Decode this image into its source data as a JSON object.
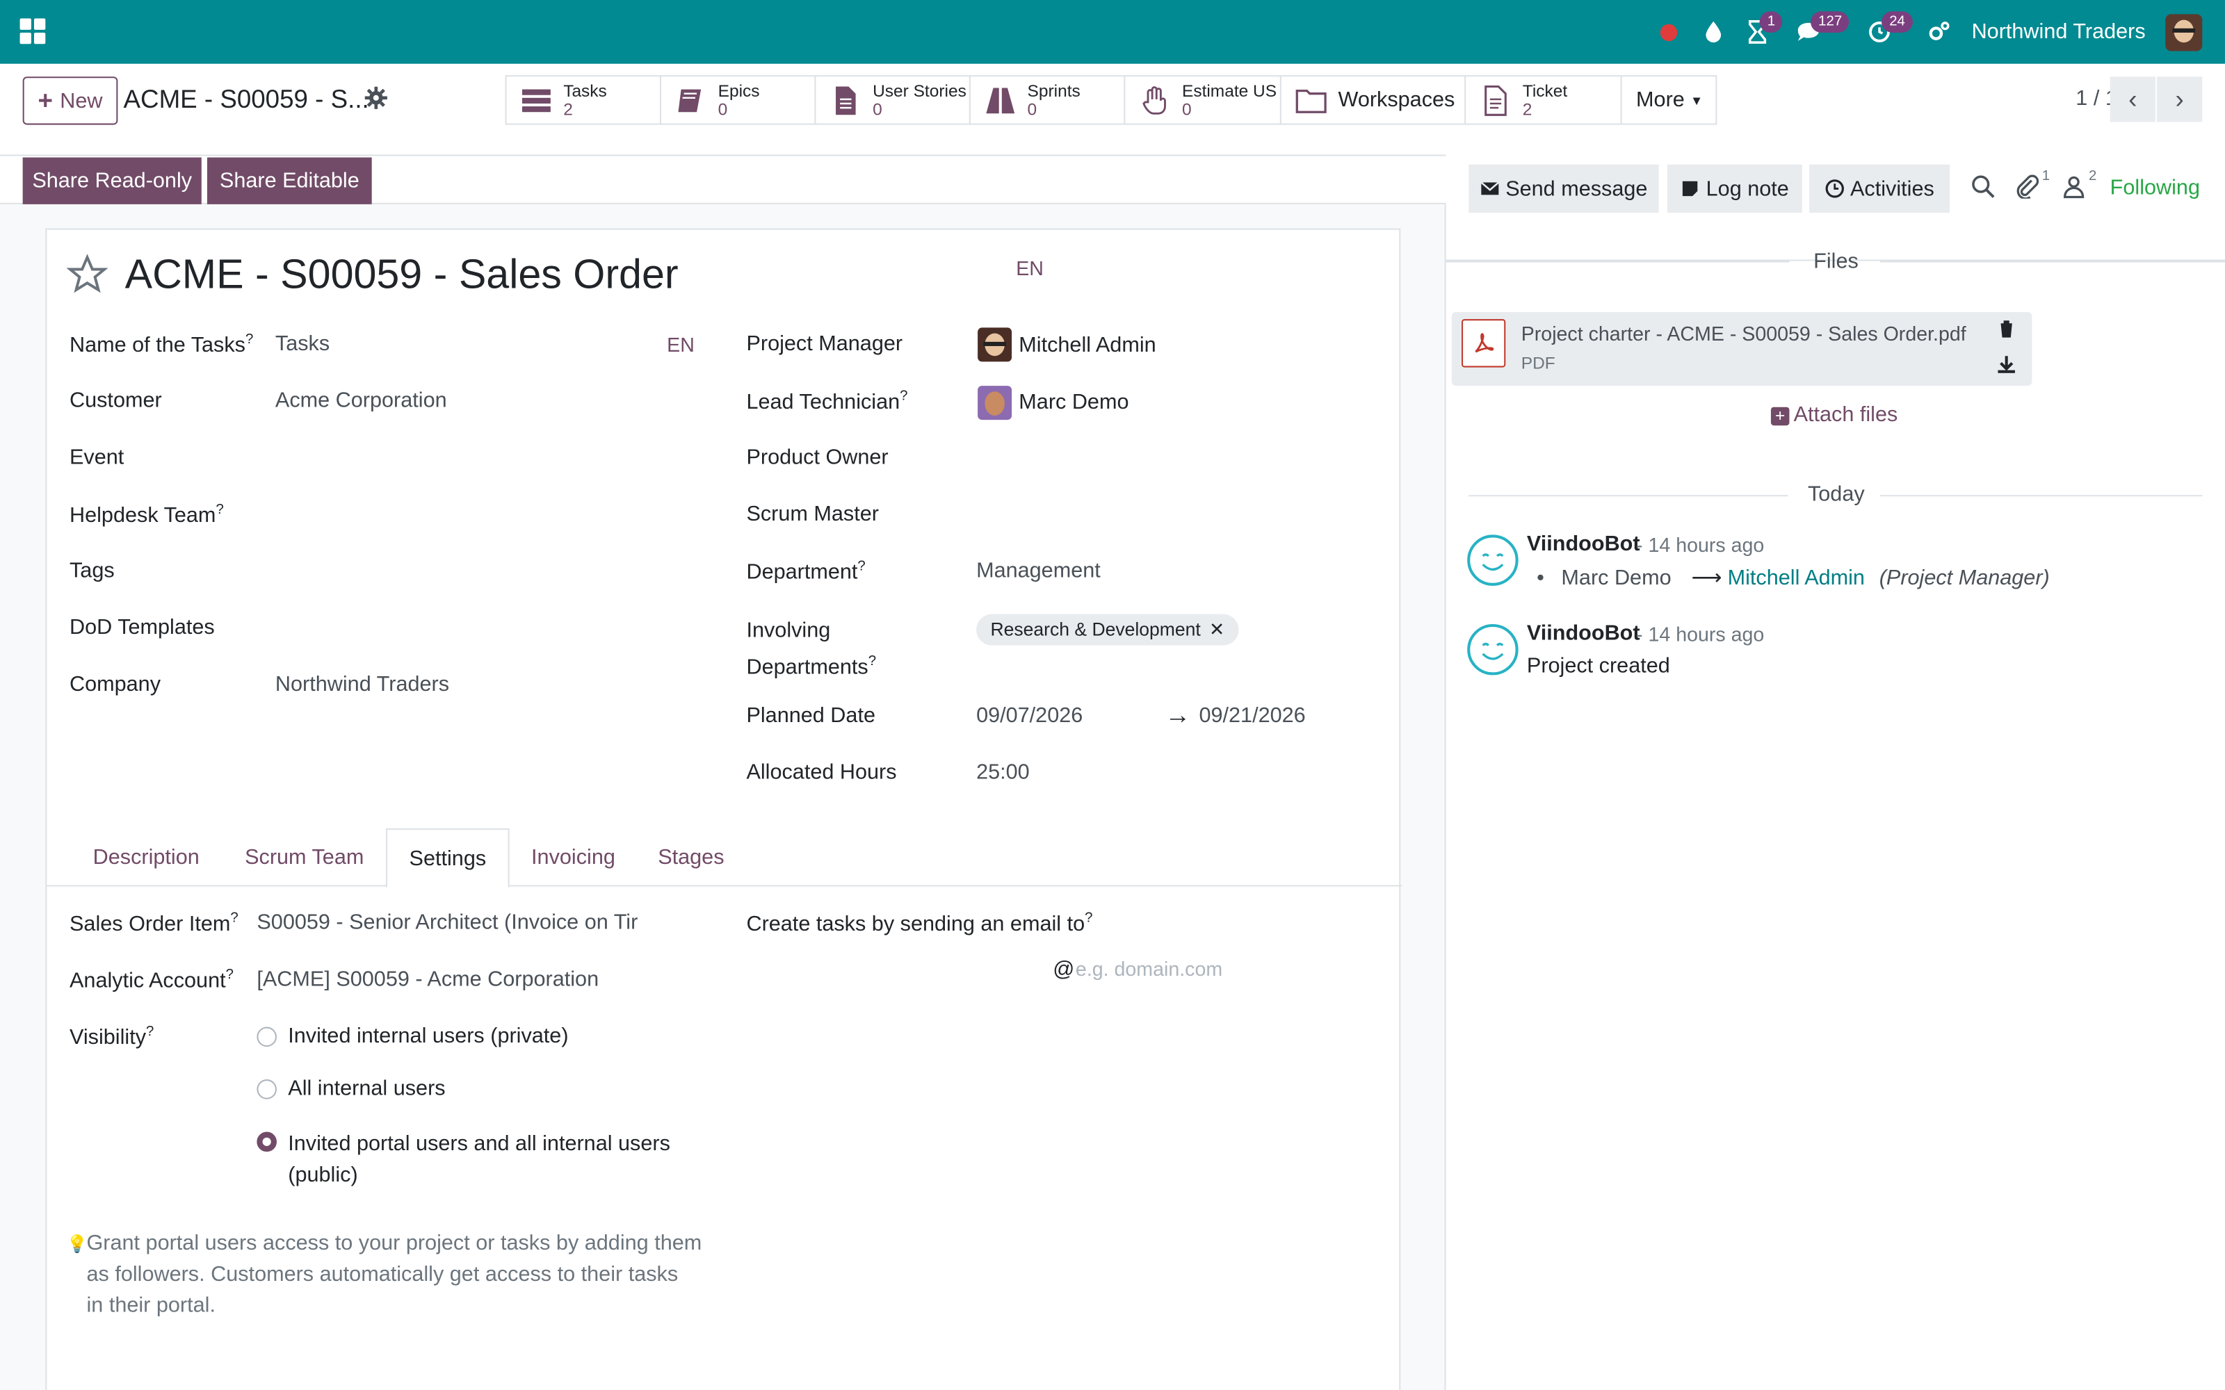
{
  "navbar": {
    "company": "Northwind Traders",
    "badges": {
      "activity": "1",
      "messages": "127",
      "timer": "24"
    }
  },
  "control": {
    "new_label": "New",
    "breadcrumb": "ACME - S00059 - S...",
    "smart_buttons": [
      {
        "label": "Tasks",
        "value": "2",
        "icon": "tasks-icon"
      },
      {
        "label": "Epics",
        "value": "0",
        "icon": "book-icon"
      },
      {
        "label": "User Stories",
        "value": "0",
        "icon": "file-icon"
      },
      {
        "label": "Sprints",
        "value": "0",
        "icon": "road-icon"
      },
      {
        "label": "Estimate US",
        "value": "0",
        "icon": "hand-icon"
      },
      {
        "label": "Workspaces",
        "value": "",
        "icon": "folder-icon"
      },
      {
        "label": "Ticket",
        "value": "2",
        "icon": "ticket-icon"
      }
    ],
    "more_label": "More",
    "pager": "1 / 1"
  },
  "statusbar": {
    "share_readonly": "Share Read-only",
    "share_editable": "Share Editable"
  },
  "form": {
    "title": "ACME - S00059 - Sales Order",
    "lang": "EN",
    "left_fields": [
      {
        "label": "Name of the Tasks",
        "help": "?",
        "value": "Tasks"
      },
      {
        "label": "Customer",
        "help": "",
        "value": "Acme Corporation"
      },
      {
        "label": "Event",
        "help": "",
        "value": ""
      },
      {
        "label": "Helpdesk Team",
        "help": "?",
        "value": ""
      },
      {
        "label": "Tags",
        "help": "",
        "value": ""
      },
      {
        "label": "DoD Templates",
        "help": "",
        "value": ""
      },
      {
        "label": "Company",
        "help": "",
        "value": "Northwind Traders"
      }
    ],
    "project_manager_label": "Project Manager",
    "project_manager": "Mitchell Admin",
    "lead_technician_label": "Lead Technician",
    "lead_technician": "Marc Demo",
    "product_owner_label": "Product Owner",
    "scrum_master_label": "Scrum Master",
    "department_label": "Department",
    "department": "Management",
    "involving_label_1": "Involving",
    "involving_label_2": "Departments",
    "involving_tag": "Research & Development",
    "planned_date_label": "Planned Date",
    "planned_start": "09/07/2026",
    "planned_end": "09/21/2026",
    "allocated_hours_label": "Allocated Hours",
    "allocated_hours": "25:00",
    "help_mark": "?"
  },
  "tabs": [
    "Description",
    "Scrum Team",
    "Settings",
    "Invoicing",
    "Stages"
  ],
  "settings": {
    "sales_order_item_label": "Sales Order Item",
    "sales_order_item": "S00059 - Senior Architect (Invoice on Tir",
    "analytic_account_label": "Analytic Account",
    "analytic_account": "[ACME] S00059 - Acme Corporation",
    "visibility_label": "Visibility",
    "visibility_options": [
      "Invited internal users (private)",
      "All internal users",
      "Invited portal users and all internal users",
      "(public)"
    ],
    "email_label": "Create tasks by sending an email to",
    "email_at": "@",
    "email_placeholder": "e.g. domain.com",
    "help_text_1": "Grant portal users access to your project or tasks by adding them",
    "help_text_2": "as followers. Customers automatically get access to their tasks",
    "help_text_3": "in their portal."
  },
  "chatter": {
    "send_message": "Send message",
    "log_note": "Log note",
    "activities": "Activities",
    "attachments_count": "1",
    "followers_count": "2",
    "following": "Following",
    "files_label": "Files",
    "attachment_name": "Project charter - ACME - S00059 - Sales Order.pdf",
    "attachment_type": "PDF",
    "attach_files": "Attach files",
    "today_label": "Today",
    "messages": [
      {
        "author": "ViindooBot",
        "time": "- 14 hours ago",
        "from": "Marc Demo",
        "to": "Mitchell Admin",
        "field": "(Project Manager)"
      },
      {
        "author": "ViindooBot",
        "time": "- 14 hours ago",
        "body": "Project created"
      }
    ]
  }
}
